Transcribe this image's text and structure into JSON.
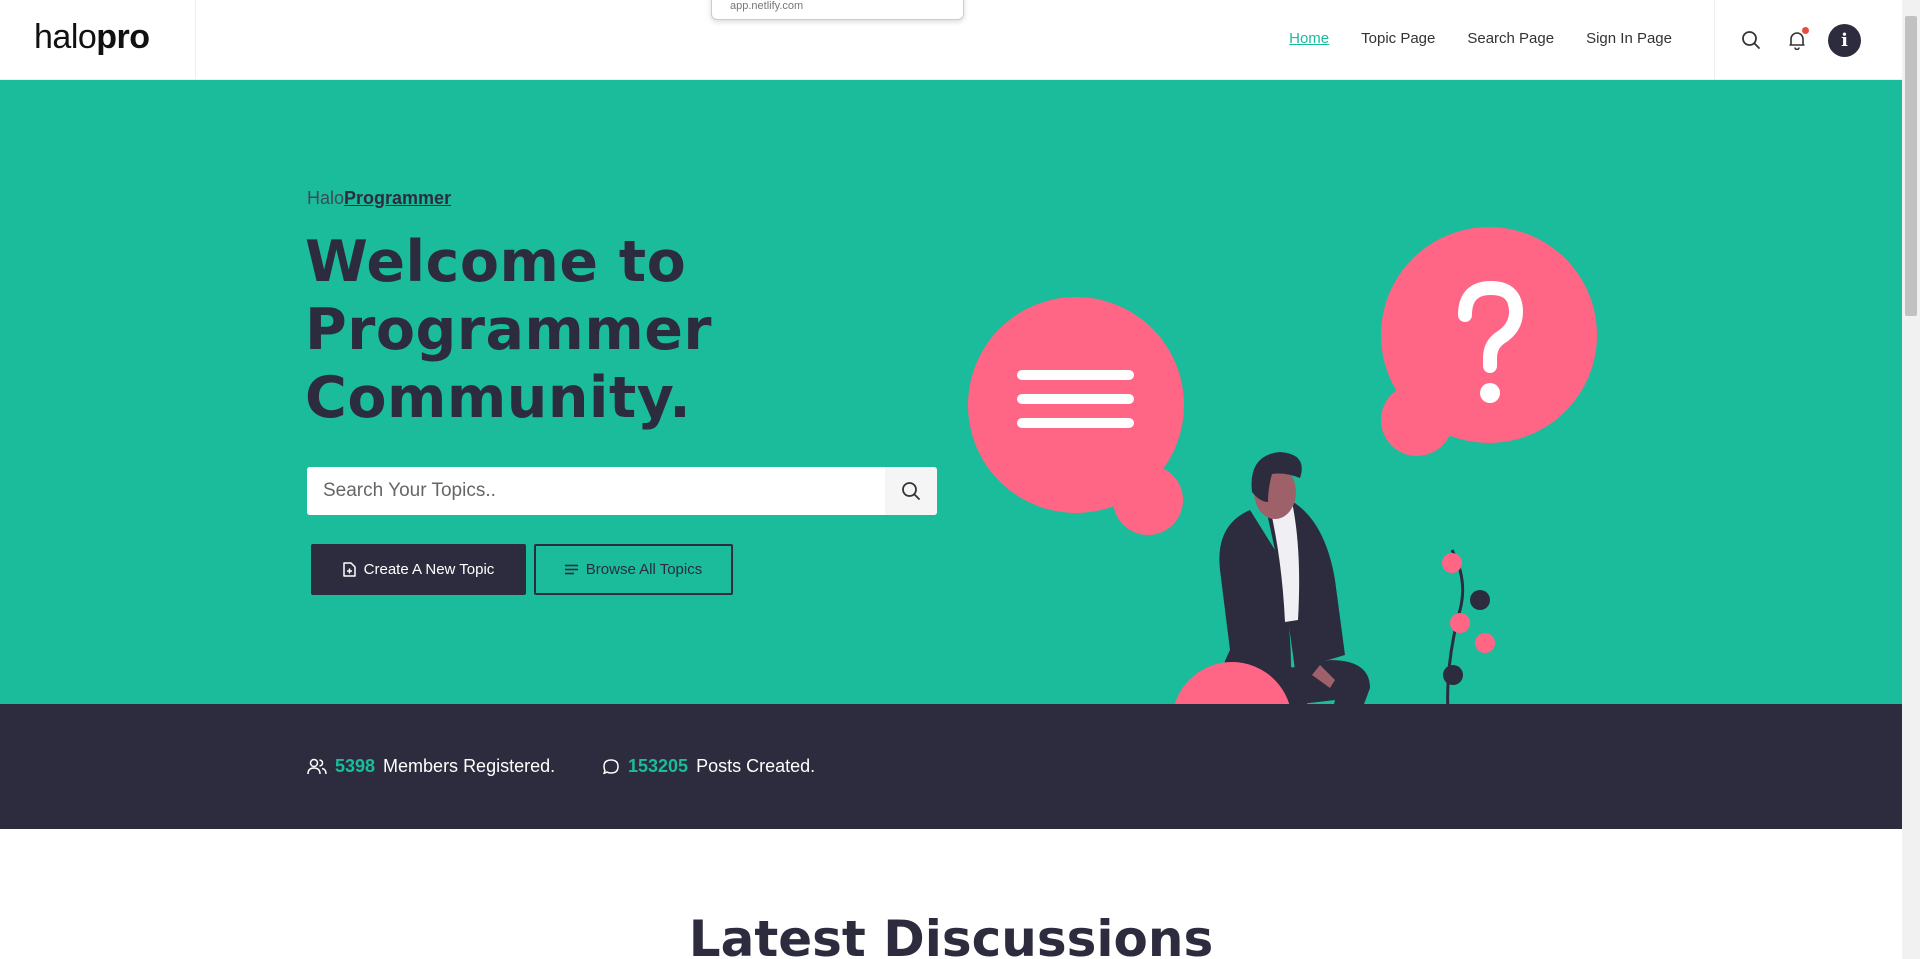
{
  "brand": {
    "logo_light": "halo",
    "logo_bold": "pro"
  },
  "url_popup": {
    "text": "app.netlify.com"
  },
  "nav": {
    "items": [
      "Home",
      "Topic Page",
      "Search Page",
      "Sign In Page"
    ],
    "active": "Home"
  },
  "header": {
    "avatar_letter": "i"
  },
  "hero": {
    "eyebrow_light": "Halo",
    "eyebrow_bold": "Programmer",
    "title_line1": "Welcome to",
    "title_line2": "Programmer",
    "title_line3": "Community.",
    "search_placeholder": "Search Your Topics..",
    "create_label": "Create A New Topic",
    "browse_label": "Browse All Topics"
  },
  "stats": {
    "members_count": "5398",
    "members_label": "Members Registered.",
    "posts_count": "153205",
    "posts_label": "Posts Created."
  },
  "latest": {
    "title": "Latest Discussions"
  },
  "colors": {
    "accent": "#1abc9c",
    "dark": "#2d2c3e",
    "pink": "#ff6584"
  }
}
